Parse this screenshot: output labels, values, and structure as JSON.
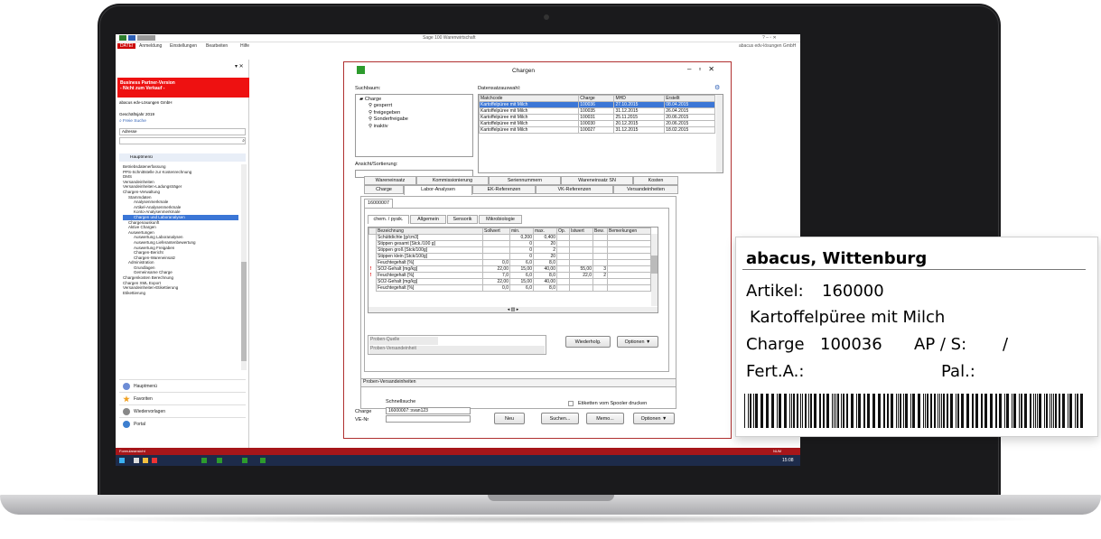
{
  "app": {
    "window_title": "Sage 100 Warenwirtschaft",
    "company": "abacus edv-lösungen GmbH",
    "menu": [
      "DATEI",
      "Anmeldung",
      "Einstellungen",
      "Bearbeiten",
      "Hilfe"
    ],
    "red_banner": [
      "Business Partner-Version",
      "- Nicht zum Verkauf -"
    ],
    "company_line": "abacus edv-Lösungen GmbH",
    "fiscal_year": "Geschäftsjahr 2019",
    "free_search": "Freie Suche",
    "address_field": "Adresse",
    "main_menu_header": "Hauptmenü",
    "tree": [
      "Betriebsdatenerfassung",
      "PPS-Schnittstelle zur Kostenrechnung",
      "DMS",
      "Versandeinheiten",
      "Versandeinheiten-Ladungsträger",
      "Chargen-Verwaltung",
      "Stammdaten",
      "Analysenmerkmale",
      "Artikel-Analysenmerkmale",
      "Konto-Analysenmerkmale",
      "Chargen und Laboranalysen",
      "Chargenauskunft",
      "Aktive Chargen",
      "Auswertungen",
      "Auswertung Laboranalysen",
      "Auswertung Lieferantenbewertung",
      "Auswertung Freigaben",
      "Chargen-Bericht",
      "Chargen-Wareneinsatz",
      "Administration",
      "Grundlagen",
      "Gemeinsame Charge",
      "Chargenkosten Berechnung",
      "Chargen XML Export",
      "Versandeinheiten-Etikettierung",
      "Etikettierung"
    ],
    "nav": [
      "Hauptmenü",
      "Favoriten",
      "Wiedervorlagen",
      "Portal"
    ],
    "status_left": "Formularansicht",
    "status_right": "NUM",
    "clock": "15:08"
  },
  "dialog": {
    "title": "Chargen",
    "suchbaum_label": "Suchbaum:",
    "datensatz_label": "Datensatzauswahl:",
    "suchbaum": [
      "Charge",
      "gesperrt",
      "freigegeben",
      "Sonderfreigabe",
      "inaktiv"
    ],
    "ansicht_label": "Ansicht/Sortierung:",
    "list_headers": [
      "Matchcode",
      "Charge",
      "MHD",
      "Erstellt"
    ],
    "list_rows": [
      [
        "Kartoffelpüree mit Milch",
        "100036",
        "27.10.2015",
        "08.04.2015"
      ],
      [
        "Kartoffelpüree mit Milch",
        "100035",
        "31.12.2015",
        "26.04.2015"
      ],
      [
        "Kartoffelpüree mit Milch",
        "100031",
        "25.11.2015",
        "20.06.2015"
      ],
      [
        "Kartoffelpüree mit Milch",
        "100030",
        "20.12.2015",
        "20.06.2015"
      ],
      [
        "Kartoffelpüree mit Milch",
        "100027",
        "31.12.2015",
        "18.02.2015"
      ]
    ],
    "tabs_row1": [
      "Wareneinsatz",
      "Kommissionierung",
      "Seriennummern",
      "Wareneinsatz SN",
      "Kosten"
    ],
    "tabs_row2": [
      "Charge",
      "Labor-Analysen",
      "EK-Referenzen",
      "VK-Referenzen",
      "Versandeinheiten"
    ],
    "inner_tab": "16000007",
    "sub_tabs": [
      "chem. / pysik.",
      "Allgemein",
      "Sensorik",
      "Mikrobiologie"
    ],
    "grid_headers": [
      "Bezeichnung",
      "Sollwert",
      "min.",
      "max.",
      "Op.",
      "Istwert",
      "Bew.",
      "Bemerkungen"
    ],
    "grid_rows": [
      {
        "flag": "",
        "cells": [
          "Schüttdichte [g/cm3]",
          "",
          "0,200",
          "0,400",
          "",
          "",
          "",
          ""
        ]
      },
      {
        "flag": "",
        "cells": [
          "Stippen gesamt [Stck./100 g]",
          "",
          "0",
          "20",
          "",
          "",
          "",
          ""
        ]
      },
      {
        "flag": "",
        "cells": [
          "Stippen groß [Stck/100g]",
          "",
          "0",
          "2",
          "",
          "",
          "",
          ""
        ]
      },
      {
        "flag": "",
        "cells": [
          "Stippen klein [Stck/100g]",
          "",
          "0",
          "20",
          "",
          "",
          "",
          ""
        ]
      },
      {
        "flag": "",
        "cells": [
          "Feuchtegehalt [%]",
          "0,0",
          "6,0",
          "8,0",
          "",
          "",
          "",
          ""
        ]
      },
      {
        "flag": "!",
        "cells": [
          "SO2-Gehalt [mg/kg]",
          "22,00",
          "15,00",
          "40,00",
          "",
          "55,00",
          "3",
          ""
        ]
      },
      {
        "flag": "!",
        "cells": [
          "Feuchtegehalt [%]",
          "7,0",
          "6,0",
          "8,0",
          "",
          "22,0",
          "2",
          ""
        ]
      },
      {
        "flag": "",
        "cells": [
          "SO2-Gehalt [mg/kg]",
          "22,00",
          "15,00",
          "40,00",
          "",
          "",
          "",
          ""
        ]
      },
      {
        "flag": "",
        "cells": [
          "Feuchtegehalt [%]",
          "0,0",
          "6,0",
          "8,0",
          "",
          "",
          "",
          ""
        ]
      }
    ],
    "proben_quelle": "Proben-Quelle",
    "proben_versand": "Proben-Versandeinheit",
    "btn_wiederholg": "Wiederholg.",
    "btn_optionen": "Optionen ▼",
    "proben_versandeinheiten": "Proben-Versandeinheiten",
    "schnellsuche_label": "Schnellsuche",
    "charge_label": "Charge",
    "venr_label": "VE-Nr",
    "schnellsuche_value": "16000007::svan123",
    "etiketten_label": "Etiketten vom Spooler drucken",
    "btn_neu": "Neu",
    "btn_suchen": "Suchen...",
    "btn_memo": "Memo...",
    "btn_optionen2": "Optionen ▼"
  },
  "label_card": {
    "title": "abacus, Wittenburg",
    "artikel_label": "Artikel:",
    "artikel_value": "160000",
    "product": "Kartoffelpüree mit Milch",
    "charge_label": "Charge",
    "charge_value": "100036",
    "ap_label": "AP / S:",
    "ap_value": "/",
    "fert_label": "Fert.A.:",
    "pal_label": "Pal.:"
  },
  "colors": {
    "accent_red": "#e11b22",
    "selection_blue": "#3b76d6"
  }
}
